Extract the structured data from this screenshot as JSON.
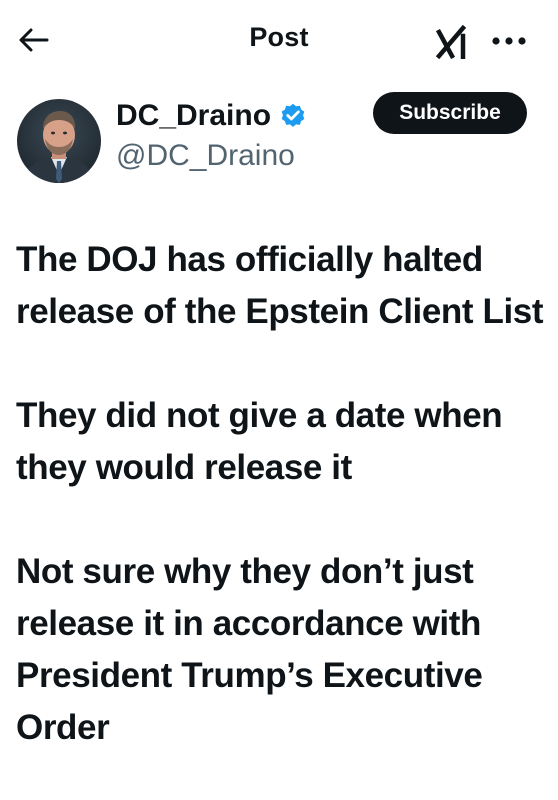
{
  "header": {
    "title": "Post",
    "back_icon": "arrow-left-icon",
    "grok_icon": "grok-icon",
    "more_icon": "more-horizontal-icon"
  },
  "author": {
    "display_name": "DC_Draino",
    "handle": "@DC_Draino",
    "verified": true,
    "verified_color": "#1d9bf0",
    "avatar_icon": "avatar-photo"
  },
  "subscribe": {
    "label": "Subscribe"
  },
  "post": {
    "paragraphs": [
      "The DOJ has officially halted release of the Epstein Client List",
      "They did not give a date when they would release it",
      "Not sure why they don’t just release it in accordance with President Trump’s Executive Order"
    ]
  }
}
